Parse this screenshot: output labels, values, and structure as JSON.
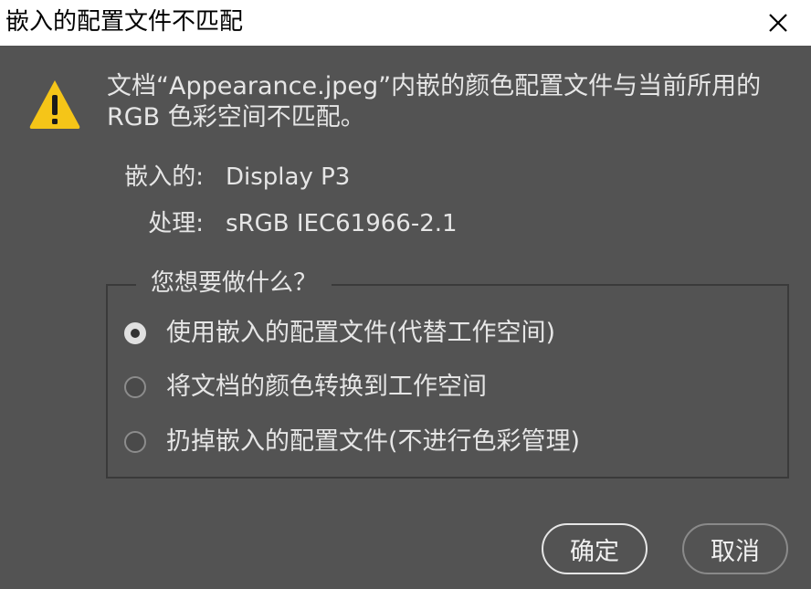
{
  "window": {
    "title": "嵌入的配置文件不匹配"
  },
  "message": "文档“Appearance.jpeg”内嵌的颜色配置文件与当前所用的 RGB 色彩空间不匹配。",
  "info": {
    "embedded_label": "嵌入的:",
    "embedded_value": "Display P3",
    "working_label": "处理:",
    "working_value": "sRGB IEC61966-2.1"
  },
  "options": {
    "legend": "您想要做什么？",
    "items": [
      {
        "label": "使用嵌入的配置文件(代替工作空间)",
        "checked": true
      },
      {
        "label": "将文档的颜色转换到工作空间",
        "checked": false
      },
      {
        "label": "扔掉嵌入的配置文件(不进行色彩管理)",
        "checked": false
      }
    ]
  },
  "buttons": {
    "ok": "确定",
    "cancel": "取消"
  },
  "icons": {
    "close": "close-icon",
    "warning": "warning-icon"
  },
  "colors": {
    "background": "#535353",
    "titlebar": "#ffffff",
    "warning_yellow": "#f5c518",
    "text": "#e6e6e6"
  }
}
